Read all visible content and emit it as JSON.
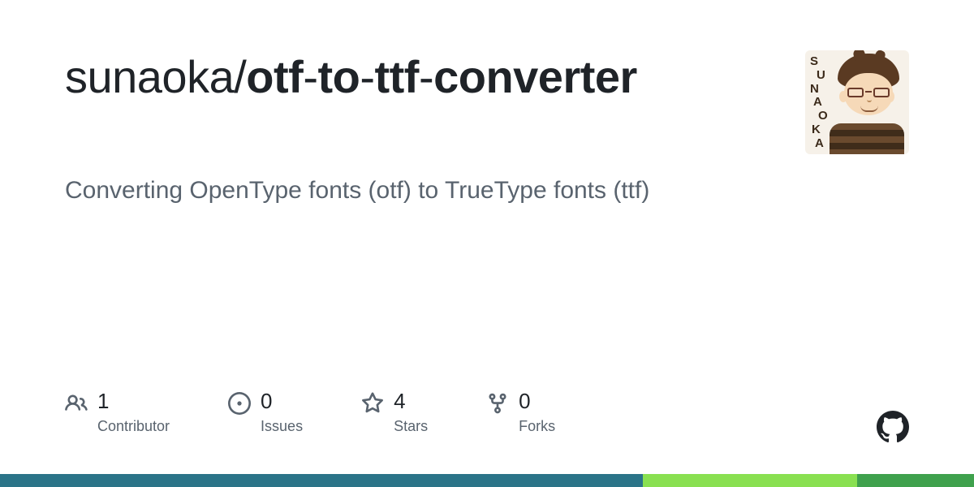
{
  "repo": {
    "owner": "sunaoka",
    "separator": "/",
    "name_parts": {
      "p1": "otf",
      "p2": "to",
      "p3": "ttf",
      "p4": "converter"
    },
    "description": "Converting OpenType fonts (otf) to TrueType fonts (ttf)"
  },
  "avatar": {
    "letters": [
      "S",
      "U",
      "N",
      "A",
      "O",
      "K",
      "A"
    ]
  },
  "stats": {
    "contributors": {
      "count": "1",
      "label": "Contributor"
    },
    "issues": {
      "count": "0",
      "label": "Issues"
    },
    "stars": {
      "count": "4",
      "label": "Stars"
    },
    "forks": {
      "count": "0",
      "label": "Forks"
    }
  },
  "language_bar": {
    "segments": [
      {
        "class": "teal",
        "pct": 66
      },
      {
        "class": "lime",
        "pct": 22
      },
      {
        "class": "green",
        "pct": 12
      }
    ]
  }
}
